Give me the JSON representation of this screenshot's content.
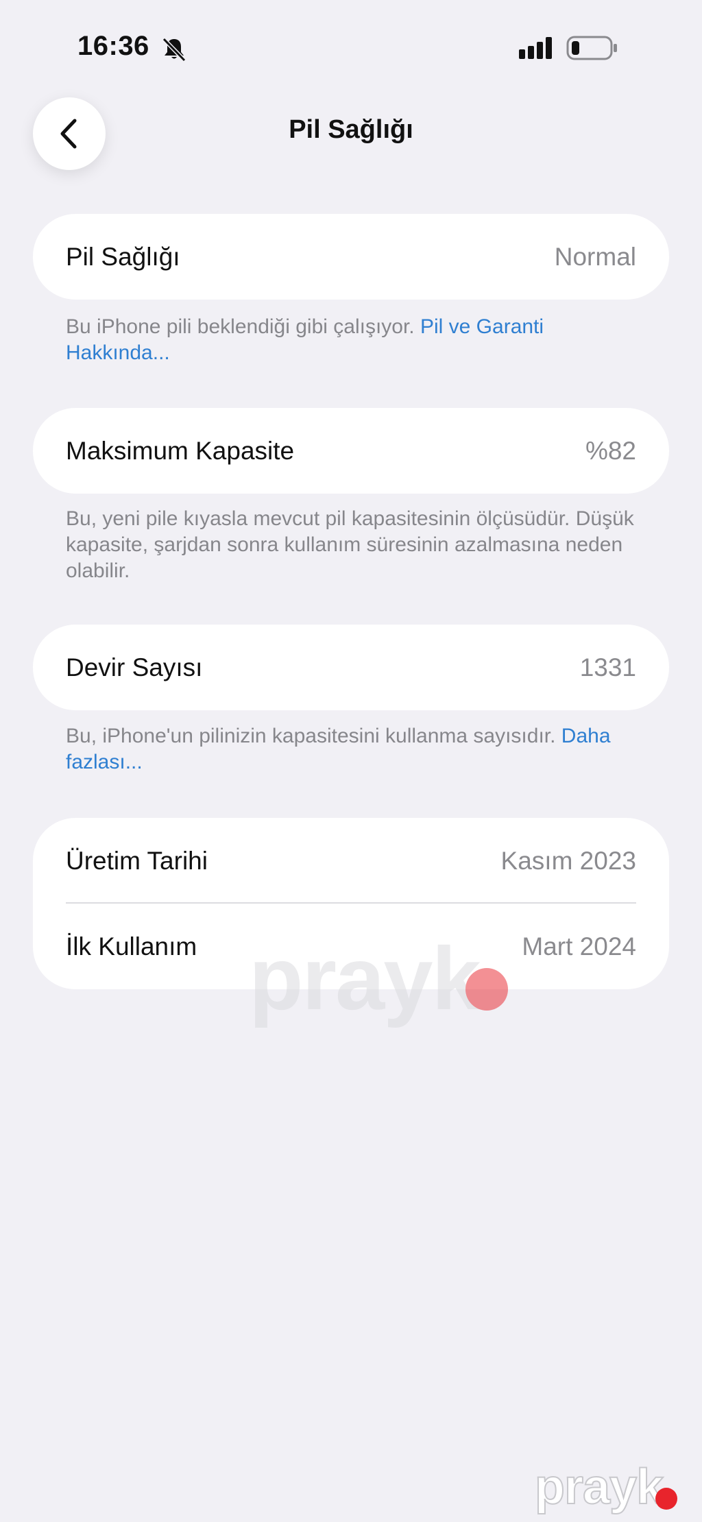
{
  "status_bar": {
    "time": "16:36",
    "icons": [
      "bell-slash-icon",
      "signal-icon",
      "battery-icon"
    ]
  },
  "header": {
    "back_icon": "chevron-left-icon",
    "title": "Pil Sağlığı"
  },
  "battery_health": {
    "label": "Pil Sağlığı",
    "value": "Normal",
    "footnote_text": "Bu iPhone pili beklendiği gibi çalışıyor. ",
    "footnote_link": "Pil ve Garanti Hakkında..."
  },
  "max_capacity": {
    "label": "Maksimum Kapasite",
    "value": "%82",
    "footnote_text": "Bu, yeni pile kıyasla mevcut pil kapasitesinin ölçüsüdür. Düşük kapasite, şarjdan sonra kullanım süresinin azalmasına neden olabilir."
  },
  "cycle_count": {
    "label": "Devir Sayısı",
    "value": "1331",
    "footnote_text": "Bu, iPhone'un pilinizin kapasitesini kullanma sayısıdır. ",
    "footnote_link": "Daha fazlası..."
  },
  "dates": {
    "manufacture_label": "Üretim Tarihi",
    "manufacture_value": "Kasım 2023",
    "first_use_label": "İlk Kullanım",
    "first_use_value": "Mart 2024"
  },
  "watermark": {
    "text": "prayk",
    "dot_color": "#e8242c"
  },
  "colors": {
    "background": "#f1f0f5",
    "link": "#2f7fd1",
    "secondary_text": "#86868b"
  }
}
